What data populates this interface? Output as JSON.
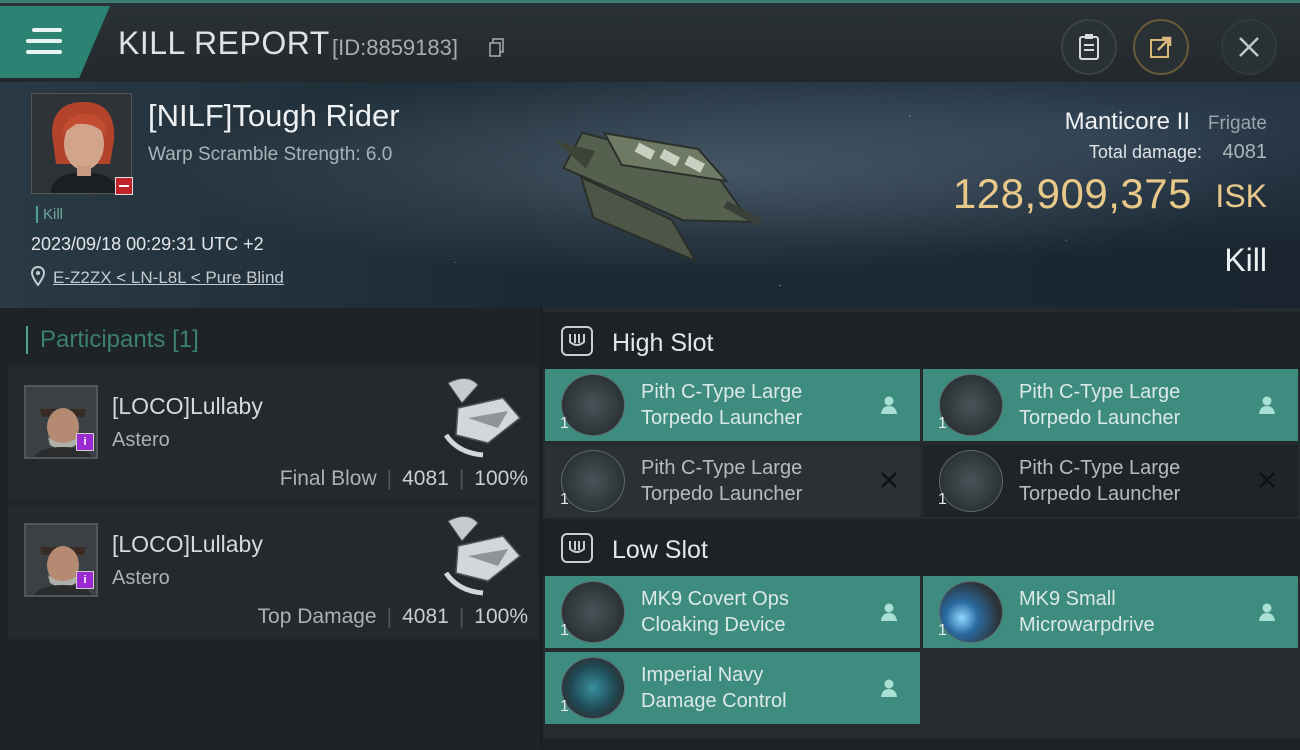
{
  "header": {
    "title": "KILL REPORT",
    "report_id": "[ID:8859183]"
  },
  "victim": {
    "name": "[NILF]Tough Rider",
    "warp_scramble": "Warp Scramble Strength: 6.0",
    "tag": "Kill",
    "time": "2023/09/18 00:29:31 UTC +2",
    "location": "E-Z2ZX < LN-L8L < Pure Blind"
  },
  "ship": {
    "name": "Manticore II",
    "class": "Frigate",
    "damage_label": "Total damage:",
    "damage_value": "4081",
    "isk_value": "128,909,375",
    "isk_unit": "ISK",
    "result": "Kill"
  },
  "participants": {
    "heading": "Participants",
    "count": "[1]",
    "rows": [
      {
        "name": "[LOCO]Lullaby",
        "ship": "Astero",
        "role": "Final Blow",
        "damage": "4081",
        "percent": "100%"
      },
      {
        "name": "[LOCO]Lullaby",
        "ship": "Astero",
        "role": "Top Damage",
        "damage": "4081",
        "percent": "100%"
      }
    ]
  },
  "fitting": {
    "high_slot": {
      "label": "High Slot",
      "modules": [
        {
          "line1": "Pith C-Type Large",
          "line2": "Torpedo Launcher",
          "qty": "1",
          "state": "dropped"
        },
        {
          "line1": "Pith C-Type Large",
          "line2": "Torpedo Launcher",
          "qty": "1",
          "state": "dropped"
        },
        {
          "line1": "Pith C-Type Large",
          "line2": "Torpedo Launcher",
          "qty": "1",
          "state": "destroyed"
        },
        {
          "line1": "Pith C-Type Large",
          "line2": "Torpedo Launcher",
          "qty": "1",
          "state": "destroyed"
        }
      ]
    },
    "low_slot": {
      "label": "Low Slot",
      "modules": [
        {
          "line1": "MK9 Covert Ops",
          "line2": "Cloaking Device",
          "qty": "1",
          "state": "dropped"
        },
        {
          "line1": "MK9 Small",
          "line2": "Microwarpdrive",
          "qty": "1",
          "state": "dropped"
        },
        {
          "line1": "Imperial Navy",
          "line2": "Damage Control",
          "qty": "1",
          "state": "dropped"
        }
      ]
    }
  },
  "icons": {
    "menu": "menu-icon",
    "copy": "copy-icon",
    "clipboard": "clipboard-icon",
    "share": "share-icon",
    "close": "close-icon",
    "location": "location-pin-icon",
    "slot": "slot-icon",
    "pilot": "pilot-icon",
    "destroyed": "x-icon"
  },
  "colors": {
    "accent": "#3d8c7f",
    "isk": "#e8c98a",
    "danger": "#c0242a"
  }
}
